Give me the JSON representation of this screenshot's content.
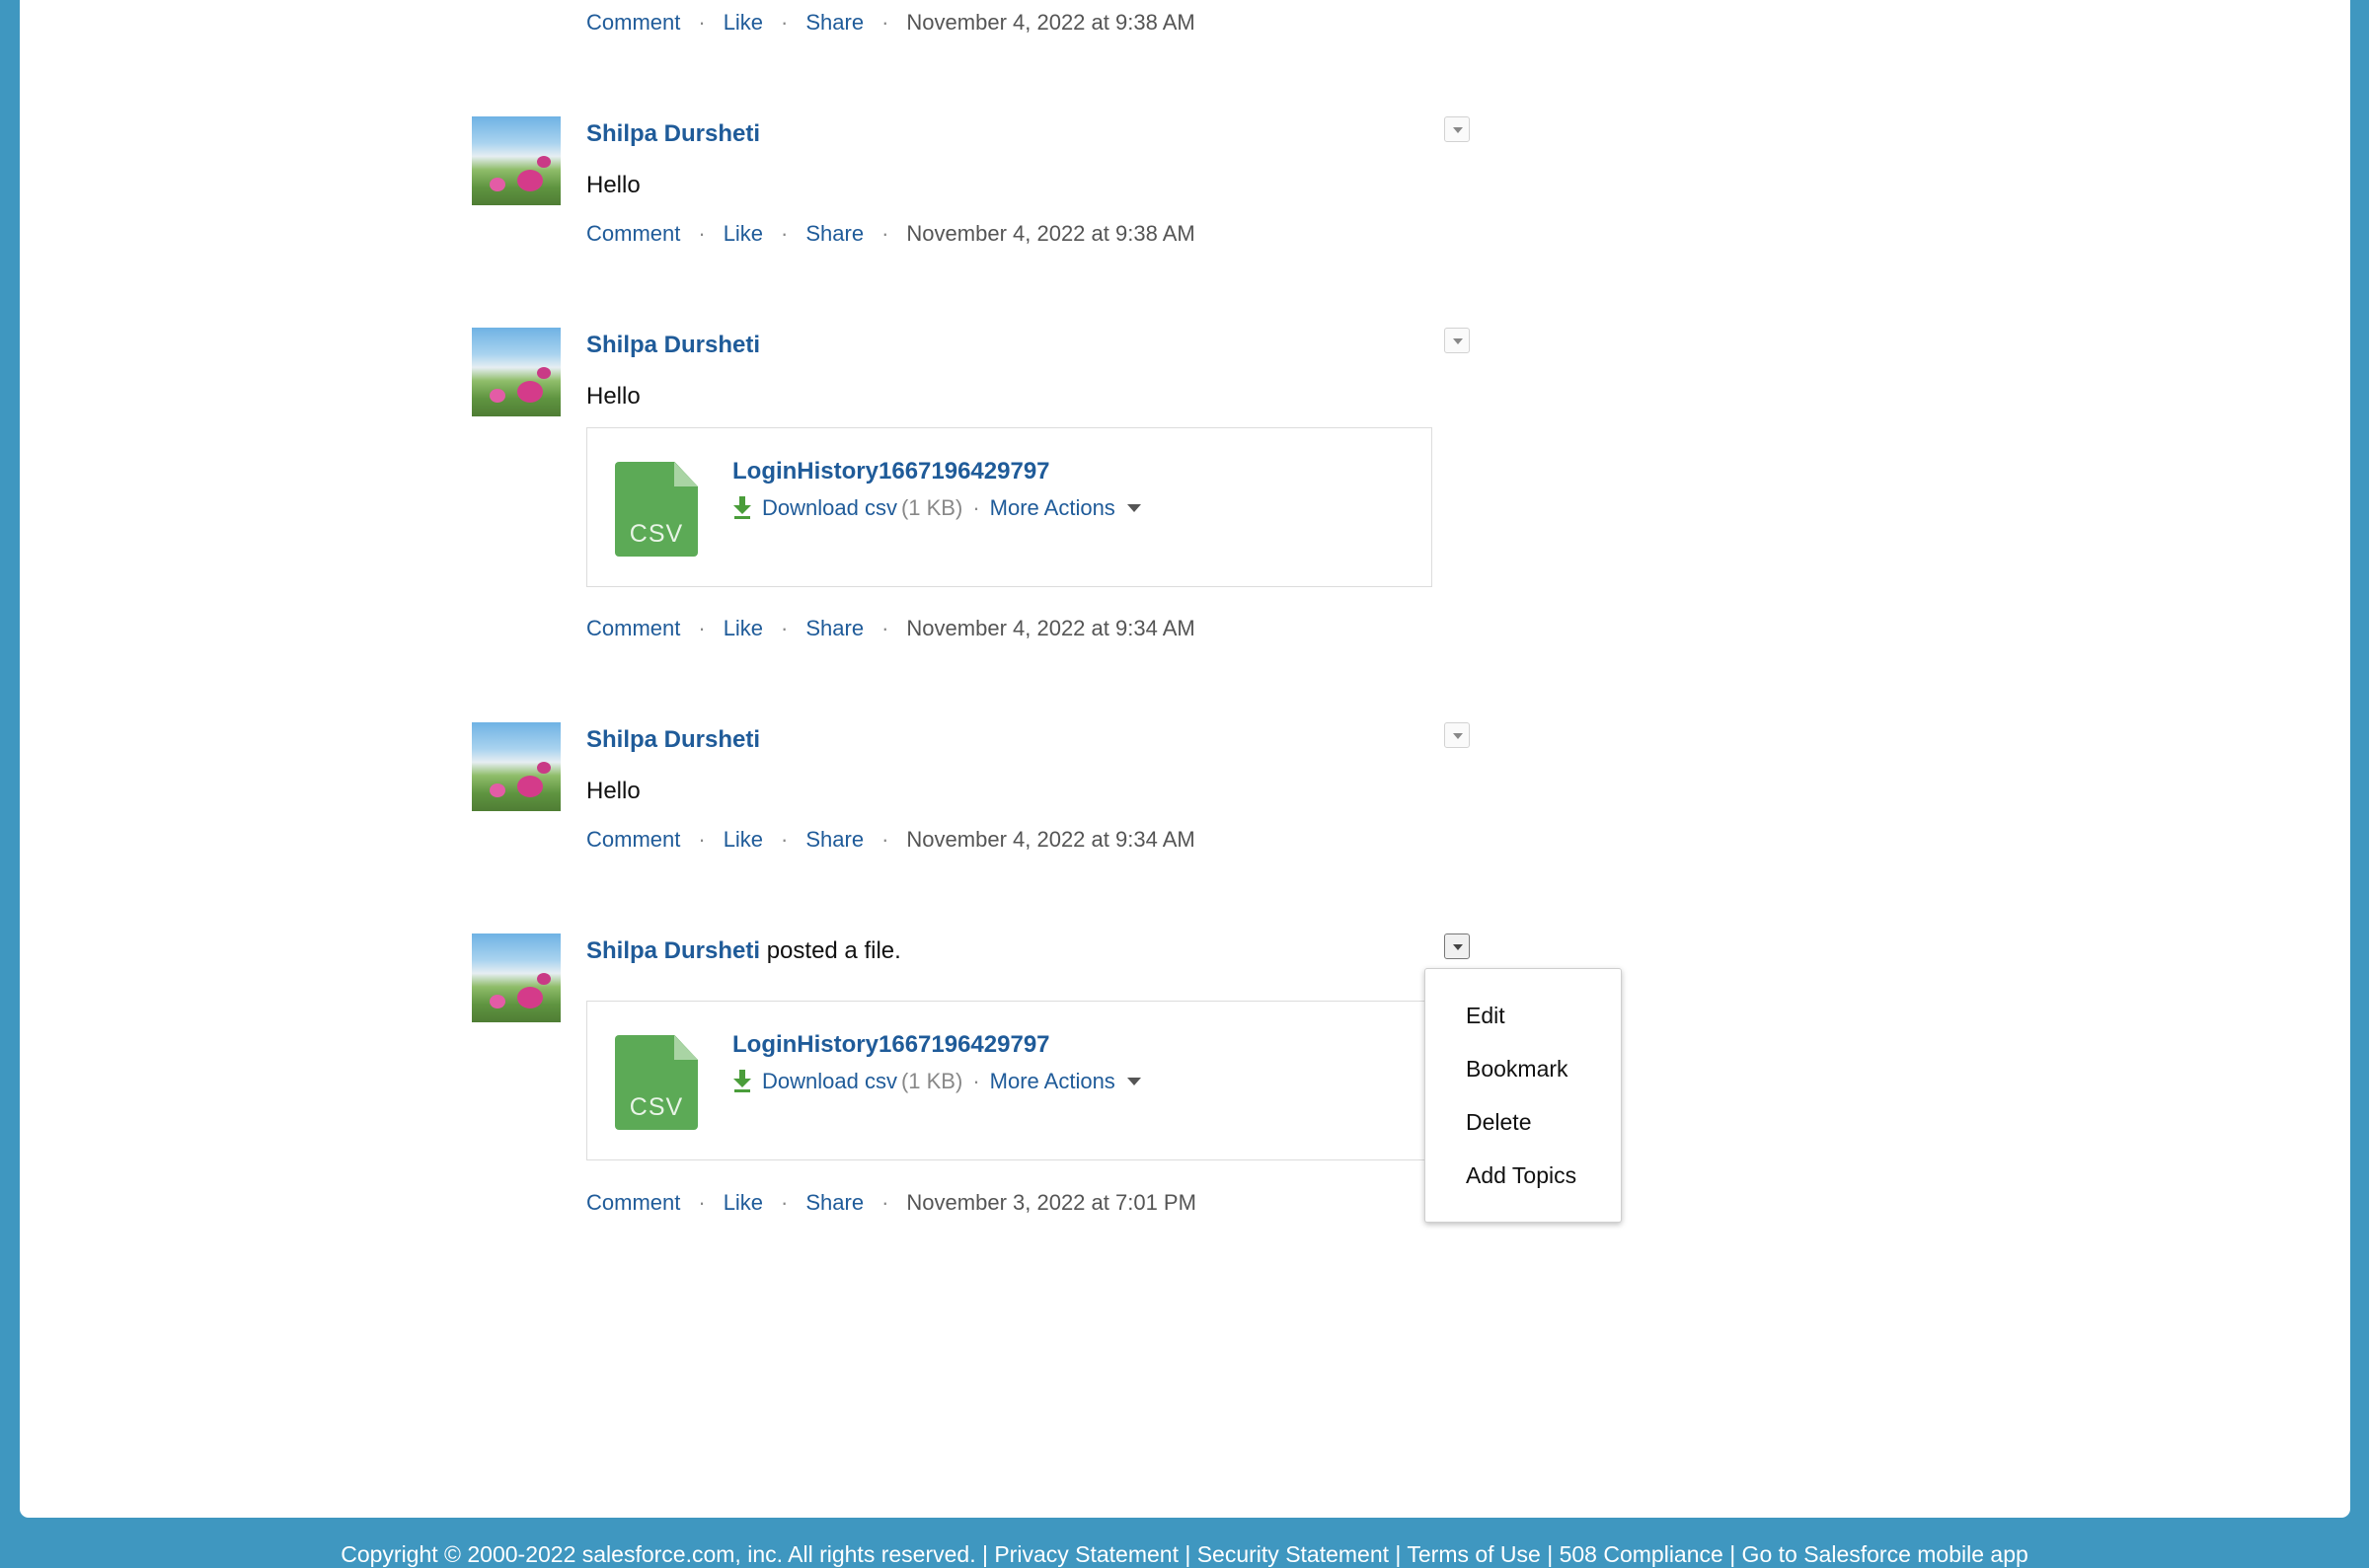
{
  "posts": [
    {
      "actions": {
        "comment": "Comment",
        "like": "Like",
        "share": "Share",
        "timestamp": "November 4, 2022 at 9:38 AM"
      }
    },
    {
      "author": "Shilpa Dursheti",
      "text": "Hello",
      "actions": {
        "comment": "Comment",
        "like": "Like",
        "share": "Share",
        "timestamp": "November 4, 2022 at 9:38 AM"
      }
    },
    {
      "author": "Shilpa Dursheti",
      "text": "Hello",
      "file": {
        "icon_label": "CSV",
        "name": "LoginHistory1667196429797",
        "download_label": "Download csv",
        "size": "(1 KB)",
        "more_actions_label": "More Actions"
      },
      "actions": {
        "comment": "Comment",
        "like": "Like",
        "share": "Share",
        "timestamp": "November 4, 2022 at 9:34 AM"
      }
    },
    {
      "author": "Shilpa Dursheti",
      "text": "Hello",
      "actions": {
        "comment": "Comment",
        "like": "Like",
        "share": "Share",
        "timestamp": "November 4, 2022 at 9:34 AM"
      }
    },
    {
      "author": "Shilpa Dursheti",
      "activity": "posted a file.",
      "file": {
        "icon_label": "CSV",
        "name": "LoginHistory1667196429797",
        "download_label": "Download csv",
        "size": "(1 KB)",
        "more_actions_label": "More Actions"
      },
      "actions": {
        "comment": "Comment",
        "like": "Like",
        "share": "Share",
        "timestamp": "November 3, 2022 at 7:01 PM"
      }
    }
  ],
  "post_menu": {
    "items": [
      "Edit",
      "Bookmark",
      "Delete",
      "Add Topics"
    ]
  },
  "footer": {
    "text": "Copyright © 2000-2022 salesforce.com, inc. All rights reserved. | Privacy Statement | Security Statement | Terms of Use | 508 Compliance | Go to Salesforce mobile app"
  },
  "colors": {
    "background": "#3f97c0",
    "link": "#1f5b99",
    "csv_icon": "#5caa56"
  }
}
